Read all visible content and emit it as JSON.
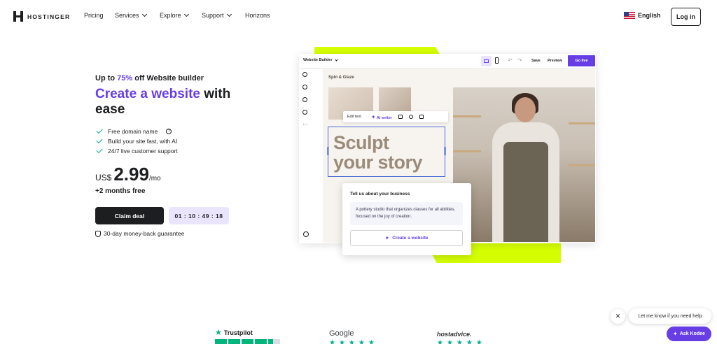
{
  "header": {
    "logo_text": "HOSTINGER",
    "nav": [
      {
        "label": "Pricing",
        "has_dropdown": false
      },
      {
        "label": "Services",
        "has_dropdown": true
      },
      {
        "label": "Explore",
        "has_dropdown": true
      },
      {
        "label": "Support",
        "has_dropdown": true
      },
      {
        "label": "Horizons",
        "has_dropdown": false
      }
    ],
    "language": "English",
    "login_label": "Log in"
  },
  "hero": {
    "promo_prefix": "Up to ",
    "promo_discount": "75%",
    "promo_suffix": " off Website builder",
    "title_accent": "Create a website",
    "title_rest": " with ease",
    "features": [
      "Free domain name",
      "Build your site fast, with AI",
      "24/7 live customer support"
    ],
    "currency": "US$",
    "price": "2.99",
    "period": "/mo",
    "bonus": "+2 months free",
    "cta_label": "Claim deal",
    "timer": "01 : 10 : 49 : 18",
    "guarantee": "30-day money-back guarantee"
  },
  "builder": {
    "selector_label": "Website Builder",
    "save_label": "Save",
    "preview_label": "Preview",
    "golive_label": "Go live",
    "site_name": "Spin & Glaze",
    "edit_text_label": "Edit text",
    "ai_writer_label": "AI writer",
    "headline_line1": "Sculpt",
    "headline_line2": "your story",
    "prompt_title": "Tell us about your business",
    "prompt_text": "A pottery studio that organizes classes for all abilities, focused on the joy of creation.",
    "create_label": "Create a website"
  },
  "ratings": {
    "trustpilot": "Trustpilot",
    "google": "Google",
    "hostadvice": "hostadvice."
  },
  "chat": {
    "close_glyph": "✕",
    "bubble_text": "Let me know if you need help",
    "ask_label": "Ask Kodee"
  },
  "colors": {
    "brand": "#673de6",
    "lime": "#d5ff00",
    "dark": "#1d1e20",
    "check": "#00b090"
  }
}
